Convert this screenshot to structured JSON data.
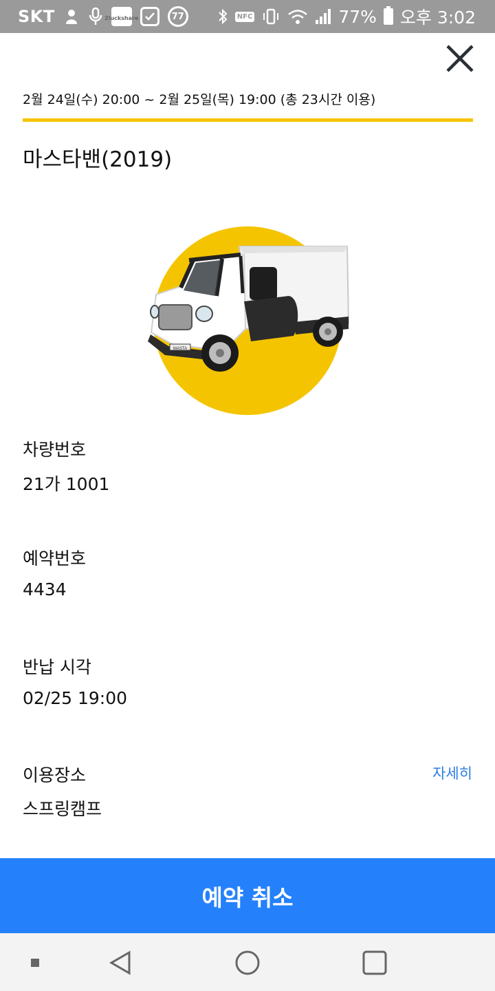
{
  "status_bar": {
    "carrier": "SKT",
    "app_badge": [
      "2luck",
      "share"
    ],
    "circle_badge": "77",
    "nfc": "NFC",
    "battery": "77%",
    "time": "오후 3:02"
  },
  "icons": {
    "close": "close-icon",
    "back": "back-icon",
    "home": "home-icon",
    "recents": "recents-icon"
  },
  "reservation": {
    "period": "2월 24일(수) 20:00 ~ 2월 25일(목) 19:00 (총 23시간 이용)",
    "car_name": "마스타밴(2019)",
    "car_badge": "MASTA"
  },
  "details": {
    "plate_label": "차량번호",
    "plate_value": "21가 1001",
    "booking_label": "예약번호",
    "booking_value": "4434",
    "return_label": "반납 시각",
    "return_value": "02/25 19:00",
    "place_label": "이용장소",
    "place_value": "스프링캠프",
    "place_detail_link": "자세히"
  },
  "actions": {
    "cancel_label": "예약 취소"
  },
  "colors": {
    "accent_yellow": "#f5c400",
    "primary_blue": "#2581fb",
    "link_blue": "#2b7de1"
  }
}
